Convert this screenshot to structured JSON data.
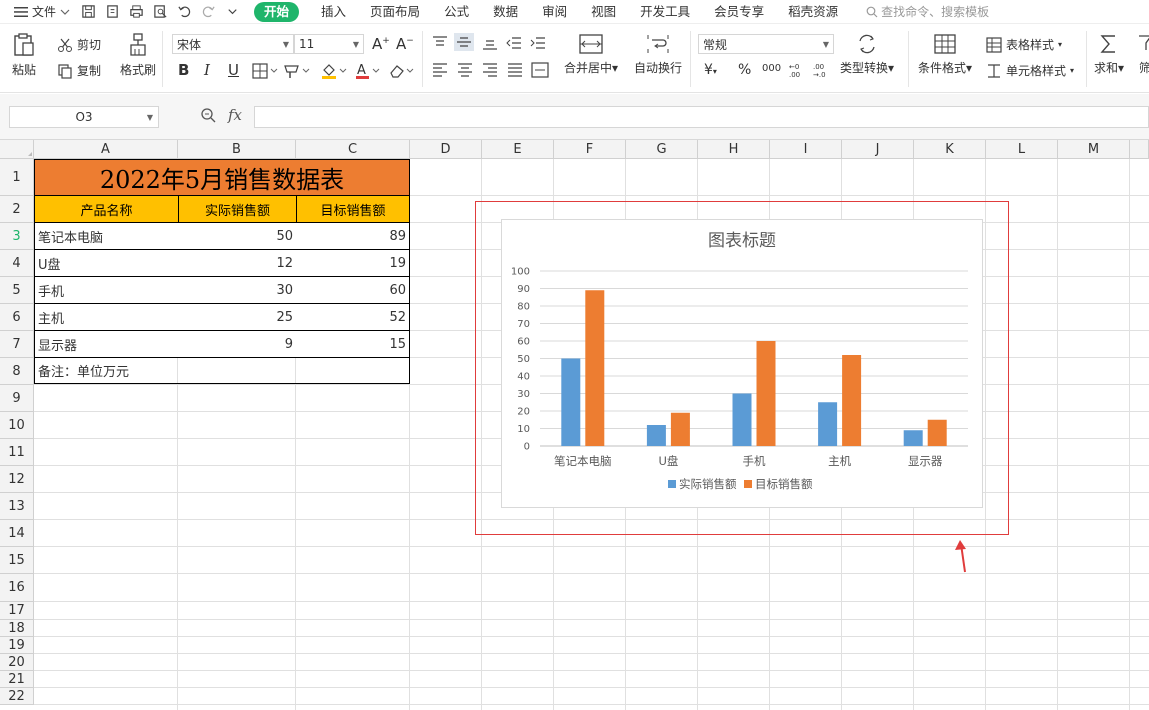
{
  "menubar": {
    "file_label": "文件",
    "tabs": [
      "开始",
      "插入",
      "页面布局",
      "公式",
      "数据",
      "审阅",
      "视图",
      "开发工具",
      "会员专享",
      "稻壳资源"
    ],
    "search_placeholder": "查找命令、搜索模板"
  },
  "ribbon": {
    "paste": "粘贴",
    "cut": "剪切",
    "copy": "复制",
    "format_painter": "格式刷",
    "font_name": "宋体",
    "font_size": "11",
    "bold": "B",
    "italic": "I",
    "underline": "U",
    "merge_center": "合并居中",
    "wrap_text": "自动换行",
    "number_format": "常规",
    "currency": "¥",
    "percent": "%",
    "thousands": "000",
    "type_convert": "类型转换",
    "conditional_format": "条件格式",
    "table_style": "表格样式",
    "cell_style": "单元格样式",
    "sum": "求和",
    "filter_partial": "筛"
  },
  "formula_bar": {
    "name_box": "O3",
    "fx": "fx",
    "formula": ""
  },
  "columns": [
    "A",
    "B",
    "C",
    "D",
    "E",
    "F",
    "G",
    "H",
    "I",
    "J",
    "K",
    "L",
    "M"
  ],
  "rows": [
    "1",
    "2",
    "3",
    "4",
    "5",
    "6",
    "7",
    "8",
    "9",
    "10",
    "11",
    "12",
    "13",
    "14",
    "15",
    "16",
    "17",
    "18",
    "19",
    "20",
    "21",
    "22"
  ],
  "sheet": {
    "title": "2022年5月销售数据表",
    "headers": [
      "产品名称",
      "实际销售额",
      "目标销售额"
    ],
    "records": [
      {
        "name": "笔记本电脑",
        "actual": "50",
        "target": "89"
      },
      {
        "name": "U盘",
        "actual": "12",
        "target": "19"
      },
      {
        "name": "手机",
        "actual": "30",
        "target": "60"
      },
      {
        "name": "主机",
        "actual": "25",
        "target": "52"
      },
      {
        "name": "显示器",
        "actual": "9",
        "target": "15"
      }
    ],
    "note": "备注：单位万元"
  },
  "chart_data": {
    "type": "bar",
    "title": "图表标题",
    "categories": [
      "笔记本电脑",
      "U盘",
      "手机",
      "主机",
      "显示器"
    ],
    "series": [
      {
        "name": "实际销售额",
        "values": [
          50,
          12,
          30,
          25,
          9
        ],
        "color": "#5b9bd5"
      },
      {
        "name": "目标销售额",
        "values": [
          89,
          19,
          60,
          52,
          15
        ],
        "color": "#ed7d31"
      }
    ],
    "ylim": [
      0,
      100
    ],
    "yticks": [
      0,
      10,
      20,
      30,
      40,
      50,
      60,
      70,
      80,
      90,
      100
    ],
    "grid": true,
    "legend": "bottom"
  },
  "colors": {
    "accent_green": "#1fb56b",
    "title_fill": "#ed7d31",
    "header_fill": "#ffc000",
    "selection_border": "#e03c3c"
  }
}
